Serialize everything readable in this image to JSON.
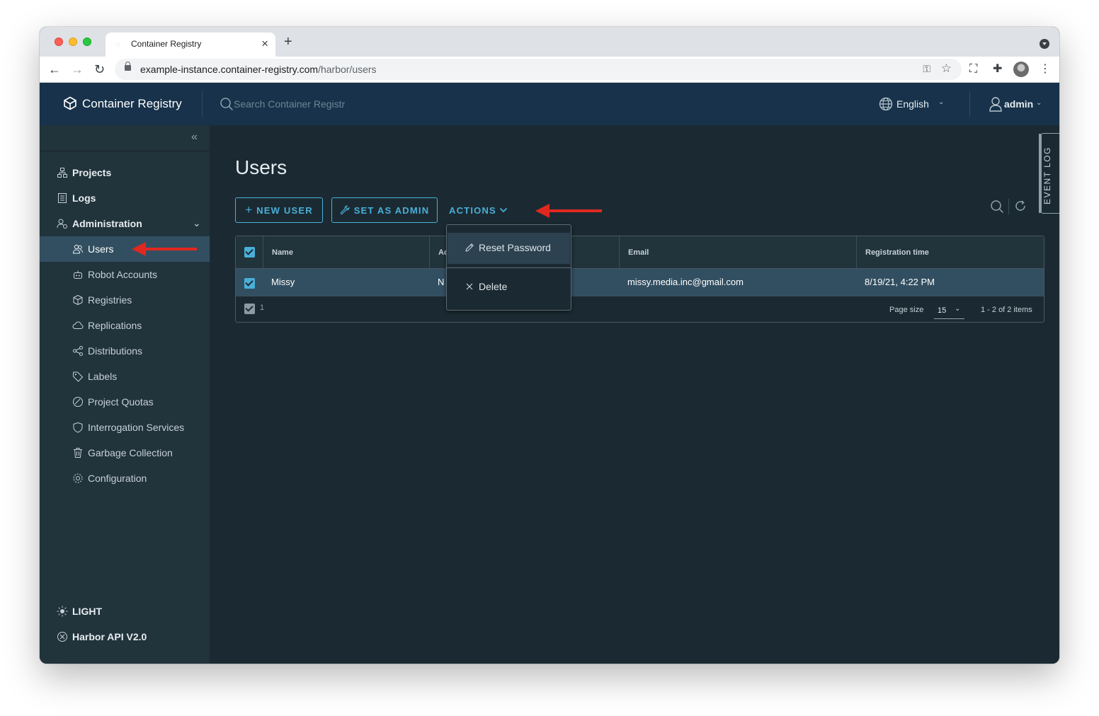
{
  "browser": {
    "tab_title": "Container Registry",
    "url_host": "example-instance.container-registry.com",
    "url_path": "/harbor/users"
  },
  "header": {
    "brand": "Container Registry",
    "search_placeholder": "Search Container Registr",
    "language": "English",
    "user": "admin"
  },
  "sidebar": {
    "items": [
      {
        "label": "Projects",
        "icon": "projects-icon"
      },
      {
        "label": "Logs",
        "icon": "logs-icon"
      },
      {
        "label": "Administration",
        "icon": "administration-icon"
      },
      {
        "label": "Users",
        "icon": "users-icon"
      },
      {
        "label": "Robot Accounts",
        "icon": "robot-icon"
      },
      {
        "label": "Registries",
        "icon": "registries-icon"
      },
      {
        "label": "Replications",
        "icon": "replications-icon"
      },
      {
        "label": "Distributions",
        "icon": "distributions-icon"
      },
      {
        "label": "Labels",
        "icon": "labels-icon"
      },
      {
        "label": "Project Quotas",
        "icon": "quotas-icon"
      },
      {
        "label": "Interrogation Services",
        "icon": "shield-icon"
      },
      {
        "label": "Garbage Collection",
        "icon": "trash-icon"
      },
      {
        "label": "Configuration",
        "icon": "gear-icon"
      }
    ],
    "theme_toggle": "LIGHT",
    "api_link": "Harbor API V2.0"
  },
  "main": {
    "title": "Users",
    "new_user": "NEW USER",
    "set_as_admin": "SET AS ADMIN",
    "actions": "ACTIONS",
    "event_log": "EVENT LOG",
    "actions_menu": {
      "reset_password": "Reset Password",
      "delete": "Delete"
    },
    "table": {
      "columns": [
        "Name",
        "Ad",
        "Email",
        "Registration time"
      ],
      "rows": [
        {
          "name": "Missy",
          "admin": "N",
          "email": "missy.media.inc@gmail.com",
          "registration_time": "8/19/21, 4:22 PM"
        }
      ],
      "selected_count": "1",
      "page_size_label": "Page size",
      "page_size": "15",
      "page_range": "1 - 2 of 2 items"
    }
  },
  "colors": {
    "accent": "#49afd9",
    "header_bg": "#17324a",
    "sidebar_bg": "#21333b",
    "main_bg": "#1b2a32",
    "annotation_arrow": "#e02720"
  }
}
